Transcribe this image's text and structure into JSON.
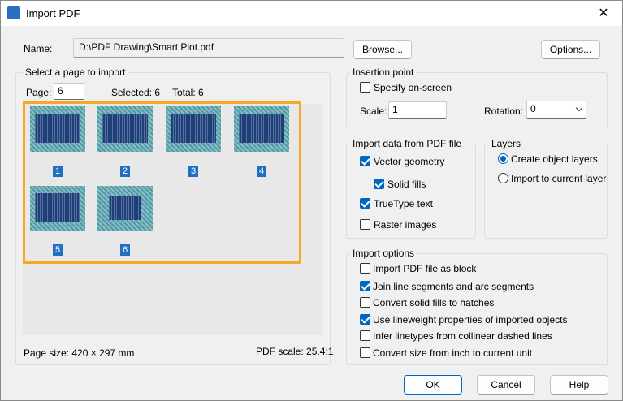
{
  "window": {
    "title": "Import PDF",
    "close_glyph": "✕"
  },
  "name_row": {
    "label": "Name:",
    "value": "D:\\PDF Drawing\\Smart Plot.pdf",
    "browse_label": "Browse...",
    "options_label": "Options..."
  },
  "page_select": {
    "group_title": "Select a page to import",
    "page_label": "Page:",
    "page_value": "6",
    "selected_text": "Selected: 6",
    "total_text": "Total: 6",
    "thumbnails": [
      {
        "number": "1"
      },
      {
        "number": "2"
      },
      {
        "number": "3"
      },
      {
        "number": "4"
      },
      {
        "number": "5"
      },
      {
        "number": "6"
      }
    ],
    "page_size_text": "Page size: 420 × 297 mm",
    "pdf_scale_text": "PDF scale: 25.4:1"
  },
  "insertion_point": {
    "title": "Insertion point",
    "specify_label": "Specify on-screen",
    "specify_checked": false,
    "scale_label": "Scale:",
    "scale_value": "1",
    "rotation_label": "Rotation:",
    "rotation_value": "0"
  },
  "import_data": {
    "title": "Import data from PDF file",
    "items": [
      {
        "label": "Vector geometry",
        "checked": true
      },
      {
        "label": "Solid fills",
        "checked": true
      },
      {
        "label": "TrueType text",
        "checked": true
      },
      {
        "label": "Raster images",
        "checked": false
      }
    ]
  },
  "layers": {
    "title": "Layers",
    "options": [
      {
        "label": "Create object layers",
        "selected": true
      },
      {
        "label": "Import to current layer",
        "selected": false
      }
    ]
  },
  "import_options": {
    "title": "Import options",
    "items": [
      {
        "label": "Import PDF file as block",
        "checked": false
      },
      {
        "label": "Join line segments and arc segments",
        "checked": true
      },
      {
        "label": "Convert solid fills to hatches",
        "checked": false
      },
      {
        "label": "Use lineweight properties of imported objects",
        "checked": true
      },
      {
        "label": "Infer linetypes from collinear dashed lines",
        "checked": false
      },
      {
        "label": "Convert size from inch to current unit",
        "checked": false
      }
    ]
  },
  "buttons": {
    "ok": "OK",
    "cancel": "Cancel",
    "help": "Help"
  },
  "colors": {
    "accent": "#0067c0",
    "selection_border": "#f7a823",
    "thumb_label": "#1f6fc2"
  }
}
